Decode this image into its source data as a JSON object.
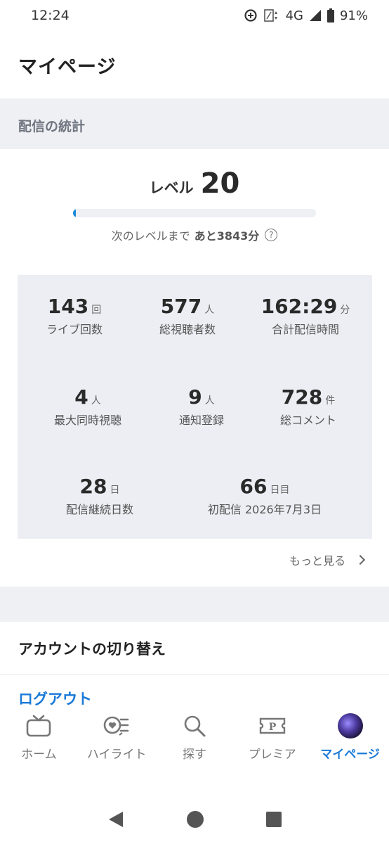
{
  "status_bar": {
    "time": "12:24",
    "network": "4G",
    "battery": "91%"
  },
  "header": {
    "title": "マイページ"
  },
  "stats_section": {
    "title": "配信の統計"
  },
  "level": {
    "label": "レベル",
    "value": "20",
    "progress_fraction": 0.012,
    "next_prefix": "次のレベルまで",
    "next_value": "あと3843分",
    "help_icon": "question-circle-icon"
  },
  "stats": [
    {
      "value": "143",
      "unit": "回",
      "label": "ライブ回数"
    },
    {
      "value": "577",
      "unit": "人",
      "label": "総視聴者数"
    },
    {
      "value": "162:29",
      "unit": "分",
      "label": "合計配信時間"
    },
    {
      "value": "4",
      "unit": "人",
      "label": "最大同時視聴"
    },
    {
      "value": "9",
      "unit": "人",
      "label": "通知登録"
    },
    {
      "value": "728",
      "unit": "件",
      "label": "総コメント"
    },
    {
      "value": "28",
      "unit": "日",
      "label": "配信継続日数"
    },
    {
      "value": "66",
      "unit": "日目",
      "label": "初配信 2026年7月3日"
    }
  ],
  "more_link": {
    "label": "もっと見る"
  },
  "account_switch": {
    "label": "アカウントの切り替え"
  },
  "logout": {
    "label": "ログアウト"
  },
  "tabs": [
    {
      "label": "ホーム",
      "icon": "tv-icon",
      "active": false
    },
    {
      "label": "ハイライト",
      "icon": "highlight-heart-icon",
      "active": false
    },
    {
      "label": "探す",
      "icon": "search-icon",
      "active": false
    },
    {
      "label": "プレミア",
      "icon": "premium-ticket-icon",
      "active": false
    },
    {
      "label": "マイページ",
      "icon": "avatar",
      "active": true
    }
  ],
  "colors": {
    "accent": "#1a7ad8",
    "progress": "#1a8ad8",
    "band": "#eef0f4",
    "stats_bg": "#eceef3"
  }
}
